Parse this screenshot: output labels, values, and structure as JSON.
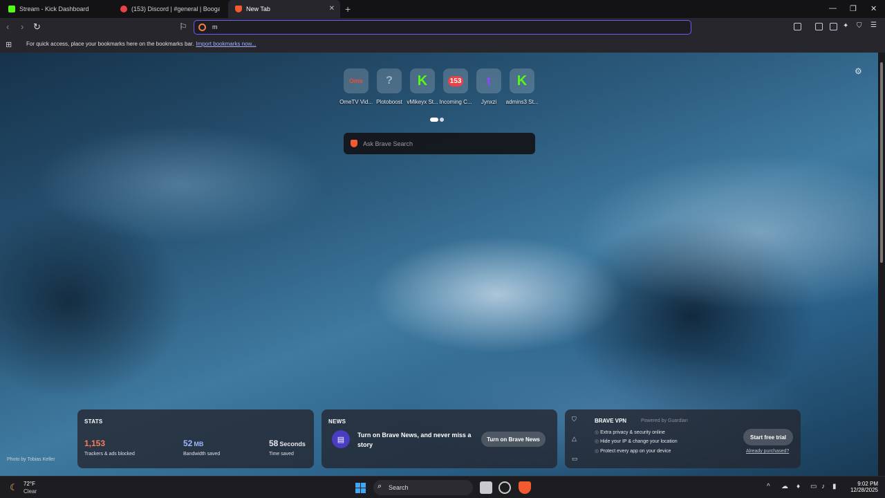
{
  "tabs": [
    {
      "title": "Stream - Kick Dashboard",
      "color": "#53fc18"
    },
    {
      "title": "(153) Discord | #general | Booga",
      "color": "#ed4245"
    },
    {
      "title": "New Tab",
      "color": "#f35a30"
    }
  ],
  "omnibox": {
    "value": "m"
  },
  "bookmarks_bar": {
    "message": "For quick access, place your bookmarks here on the bookmarks bar.",
    "import_link": "Import bookmarks now..."
  },
  "top_sites": [
    {
      "label": "OmeTV Vid...",
      "glyph": "Ome",
      "color": "#e84d3d"
    },
    {
      "label": "Plotoboost",
      "glyph": "?",
      "color": "#9fb4c8"
    },
    {
      "label": "vMikeyx St...",
      "glyph": "K",
      "color": "#53fc18"
    },
    {
      "label": "Incoming C...",
      "glyph": "153",
      "color": "#ed4245"
    },
    {
      "label": "Jynxzi",
      "glyph": "t",
      "color": "#9146ff"
    },
    {
      "label": "admins3 St...",
      "glyph": "K",
      "color": "#53fc18"
    }
  ],
  "search": {
    "placeholder": "Ask Brave Search"
  },
  "photo_credit": "Photo by Tobias Keller",
  "stats": {
    "title": "STATS",
    "trackers": {
      "value": "1,153",
      "label": "Trackers & ads blocked",
      "color": "#ff7a59"
    },
    "bandwidth": {
      "value": "52",
      "unit": "MB",
      "label": "Bandwidth saved",
      "color": "#9fb6ff"
    },
    "time": {
      "value": "58",
      "unit": "Seconds",
      "label": "Time saved",
      "color": "#ffffff"
    }
  },
  "news": {
    "title": "NEWS",
    "text": "Turn on Brave News, and never miss a story",
    "button": "Turn on Brave News"
  },
  "vpn": {
    "brand": "BRAVE VPN",
    "powered": "Powered by Guardian",
    "features": [
      "Extra privacy & security online",
      "Hide your IP & change your location",
      "Protect every app on your device"
    ],
    "cta": "Start free trial",
    "purchased": "Already purchased?"
  },
  "taskbar": {
    "temp": "72°F",
    "condition": "Clear",
    "search": "Search",
    "time": "9:02 PM",
    "date": "12/28/2025"
  }
}
